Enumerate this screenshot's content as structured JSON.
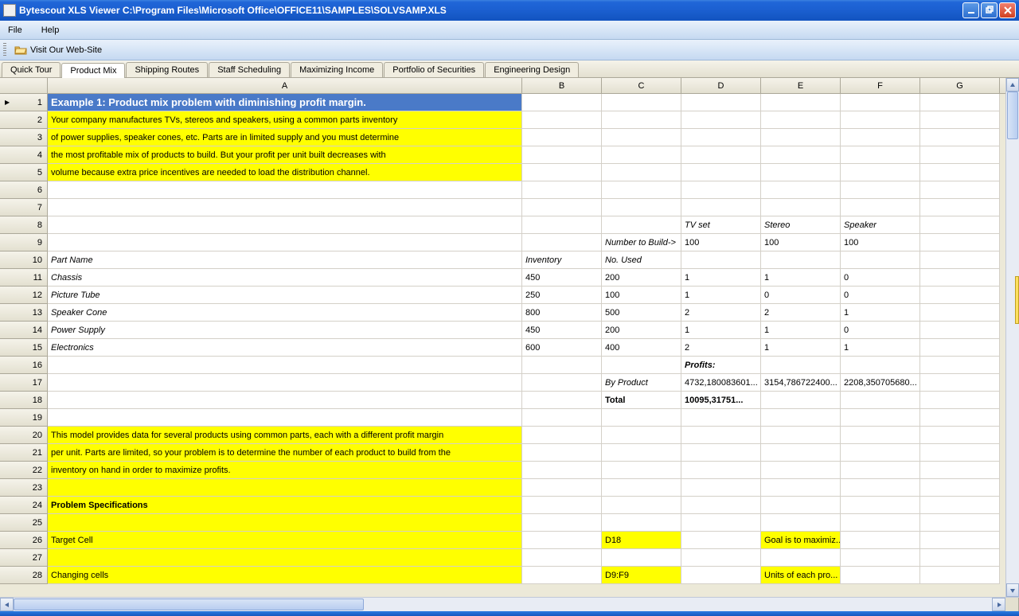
{
  "title": "Bytescout XLS Viewer C:\\Program Files\\Microsoft Office\\OFFICE11\\SAMPLES\\SOLVSAMP.XLS",
  "menu": {
    "file": "File",
    "help": "Help"
  },
  "toolbar": {
    "visit": "Visit Our Web-Site"
  },
  "tabs": [
    "Quick Tour",
    "Product Mix",
    "Shipping Routes",
    "Staff Scheduling",
    "Maximizing Income",
    "Portfolio of Securities",
    "Engineering Design"
  ],
  "activeTab": 1,
  "columns": [
    "A",
    "B",
    "C",
    "D",
    "E",
    "F",
    "G"
  ],
  "rows": [
    {
      "n": 1,
      "cells": {
        "A": {
          "t": "Example 1:  Product mix problem with diminishing profit margin.",
          "cls": "bluehead"
        }
      }
    },
    {
      "n": 2,
      "cells": {
        "A": {
          "t": "Your company manufactures TVs, stereos and speakers, using a common parts inventory",
          "cls": "yellow"
        }
      }
    },
    {
      "n": 3,
      "cells": {
        "A": {
          "t": "of power supplies, speaker cones, etc.  Parts are in limited supply and you must determine",
          "cls": "yellow"
        }
      }
    },
    {
      "n": 4,
      "cells": {
        "A": {
          "t": "the most profitable mix of products to build. But your profit per unit built decreases with",
          "cls": "yellow"
        }
      }
    },
    {
      "n": 5,
      "cells": {
        "A": {
          "t": "volume because extra price incentives are needed to load the distribution channel.",
          "cls": "yellow"
        }
      }
    },
    {
      "n": 6,
      "cells": {}
    },
    {
      "n": 7,
      "cells": {}
    },
    {
      "n": 8,
      "cells": {
        "D": {
          "t": "TV set",
          "cls": "italic"
        },
        "E": {
          "t": "Stereo",
          "cls": "italic"
        },
        "F": {
          "t": "Speaker",
          "cls": "italic"
        }
      }
    },
    {
      "n": 9,
      "cells": {
        "C": {
          "t": "Number to Build->",
          "cls": "italic"
        },
        "D": {
          "t": "100"
        },
        "E": {
          "t": "100"
        },
        "F": {
          "t": "100"
        }
      }
    },
    {
      "n": 10,
      "cells": {
        "A": {
          "t": "Part Name",
          "cls": "italic"
        },
        "B": {
          "t": "Inventory",
          "cls": "italic"
        },
        "C": {
          "t": "No. Used",
          "cls": "italic"
        }
      }
    },
    {
      "n": 11,
      "cells": {
        "A": {
          "t": "Chassis",
          "cls": "italic"
        },
        "B": {
          "t": "450"
        },
        "C": {
          "t": "200"
        },
        "D": {
          "t": "1"
        },
        "E": {
          "t": "1"
        },
        "F": {
          "t": "0"
        }
      }
    },
    {
      "n": 12,
      "cells": {
        "A": {
          "t": "Picture Tube",
          "cls": "italic"
        },
        "B": {
          "t": "250"
        },
        "C": {
          "t": "100"
        },
        "D": {
          "t": "1"
        },
        "E": {
          "t": "0"
        },
        "F": {
          "t": "0"
        }
      }
    },
    {
      "n": 13,
      "cells": {
        "A": {
          "t": "Speaker Cone",
          "cls": "italic"
        },
        "B": {
          "t": "800"
        },
        "C": {
          "t": "500"
        },
        "D": {
          "t": "2"
        },
        "E": {
          "t": "2"
        },
        "F": {
          "t": "1"
        }
      }
    },
    {
      "n": 14,
      "cells": {
        "A": {
          "t": "Power Supply",
          "cls": "italic"
        },
        "B": {
          "t": "450"
        },
        "C": {
          "t": "200"
        },
        "D": {
          "t": "1"
        },
        "E": {
          "t": "1"
        },
        "F": {
          "t": "0"
        }
      }
    },
    {
      "n": 15,
      "cells": {
        "A": {
          "t": "Electronics",
          "cls": "italic"
        },
        "B": {
          "t": "600"
        },
        "C": {
          "t": "400"
        },
        "D": {
          "t": "2"
        },
        "E": {
          "t": "1"
        },
        "F": {
          "t": "1"
        }
      }
    },
    {
      "n": 16,
      "cells": {
        "D": {
          "t": "Profits:",
          "cls": "bold italic"
        }
      }
    },
    {
      "n": 17,
      "cells": {
        "C": {
          "t": "By Product",
          "cls": "italic"
        },
        "D": {
          "t": "4732,180083601..."
        },
        "E": {
          "t": "3154,786722400..."
        },
        "F": {
          "t": "2208,350705680..."
        }
      }
    },
    {
      "n": 18,
      "cells": {
        "C": {
          "t": "Total",
          "cls": "bold"
        },
        "D": {
          "t": "10095,31751...",
          "cls": "bold"
        }
      }
    },
    {
      "n": 19,
      "cells": {}
    },
    {
      "n": 20,
      "cells": {
        "A": {
          "t": "This model provides data for several products using common parts, each with a different profit margin",
          "cls": "yellow"
        }
      }
    },
    {
      "n": 21,
      "cells": {
        "A": {
          "t": "per unit.  Parts are limited, so your problem is to determine the number of each product to build from the",
          "cls": "yellow"
        }
      }
    },
    {
      "n": 22,
      "cells": {
        "A": {
          "t": "inventory on hand in order to maximize profits.",
          "cls": "yellow"
        }
      }
    },
    {
      "n": 23,
      "cells": {
        "A": {
          "t": "",
          "cls": "yellow"
        }
      }
    },
    {
      "n": 24,
      "cells": {
        "A": {
          "t": "Problem Specifications",
          "cls": "yellow bold"
        }
      }
    },
    {
      "n": 25,
      "cells": {
        "A": {
          "t": "",
          "cls": "yellow"
        }
      }
    },
    {
      "n": 26,
      "cells": {
        "A": {
          "t": "Target Cell",
          "cls": "yellow"
        },
        "C": {
          "t": "D18",
          "cls": "yellow"
        },
        "E": {
          "t": "Goal is to maximiz...",
          "cls": "yellow"
        }
      }
    },
    {
      "n": 27,
      "cells": {
        "A": {
          "t": "",
          "cls": "yellow"
        }
      }
    },
    {
      "n": 28,
      "cells": {
        "A": {
          "t": "Changing cells",
          "cls": "yellow"
        },
        "C": {
          "t": "D9:F9",
          "cls": "yellow"
        },
        "E": {
          "t": "Units of each pro...",
          "cls": "yellow"
        }
      }
    }
  ]
}
